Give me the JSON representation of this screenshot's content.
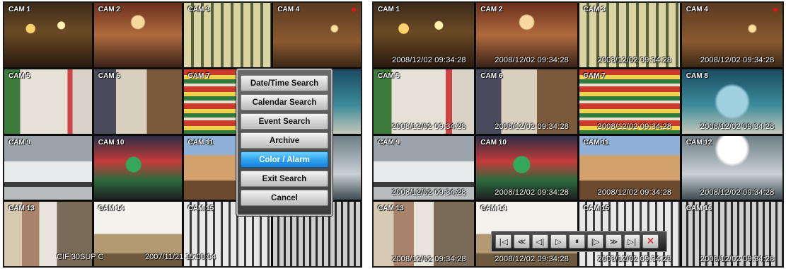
{
  "left_grid": {
    "cameras": [
      "CAM 1",
      "CAM 2",
      "CAM 3",
      "CAM 4",
      "CAM 5",
      "CAM 6",
      "CAM 7",
      "",
      "CAM 9",
      "CAM 10",
      "CAM 11",
      "",
      "CAM 13",
      "CAM 14",
      "CAM 15",
      ""
    ],
    "overlay_status": "CIF 30SUP C",
    "overlay_timestamp": "2007/11/21 15:00:04"
  },
  "search_menu": {
    "items": [
      "Date/Time Search",
      "Calendar Search",
      "Event Search",
      "Archive",
      "Color / Alarm",
      "Exit Search",
      "Cancel"
    ],
    "selected": "Color / Alarm"
  },
  "right_grid": {
    "cameras": [
      "CAM 1",
      "CAM 2",
      "CAM 3",
      "CAM 4",
      "CAM 5",
      "CAM 6",
      "CAM 7",
      "CAM 8",
      "CAM 9",
      "CAM 10",
      "CAM 11",
      "CAM 12",
      "CAM 13",
      "CAM 14",
      "CAM 15",
      "CAM 16"
    ],
    "timestamp": "2008/12/02   09:34:28"
  },
  "playback_controls": {
    "buttons": [
      {
        "name": "go-to-start",
        "icon": "skip-to-start-icon",
        "glyph": "|◁"
      },
      {
        "name": "fast-rewind",
        "icon": "fast-rewind-icon",
        "glyph": "≪"
      },
      {
        "name": "step-back",
        "icon": "step-back-icon",
        "glyph": "◁|"
      },
      {
        "name": "play",
        "icon": "play-icon",
        "glyph": "▷"
      },
      {
        "name": "pause",
        "icon": "pause-icon",
        "glyph": "⏸"
      },
      {
        "name": "step-forward",
        "icon": "step-forward-icon",
        "glyph": "|▷"
      },
      {
        "name": "fast-forward",
        "icon": "fast-forward-icon",
        "glyph": "≫"
      },
      {
        "name": "go-to-end",
        "icon": "skip-to-end-icon",
        "glyph": "▷|"
      },
      {
        "name": "close",
        "icon": "close-icon",
        "glyph": "✕"
      }
    ]
  },
  "colors": {
    "menu_highlight": "#2fa4ef",
    "record_indicator": "#e21515",
    "close_button": "#e02020"
  }
}
